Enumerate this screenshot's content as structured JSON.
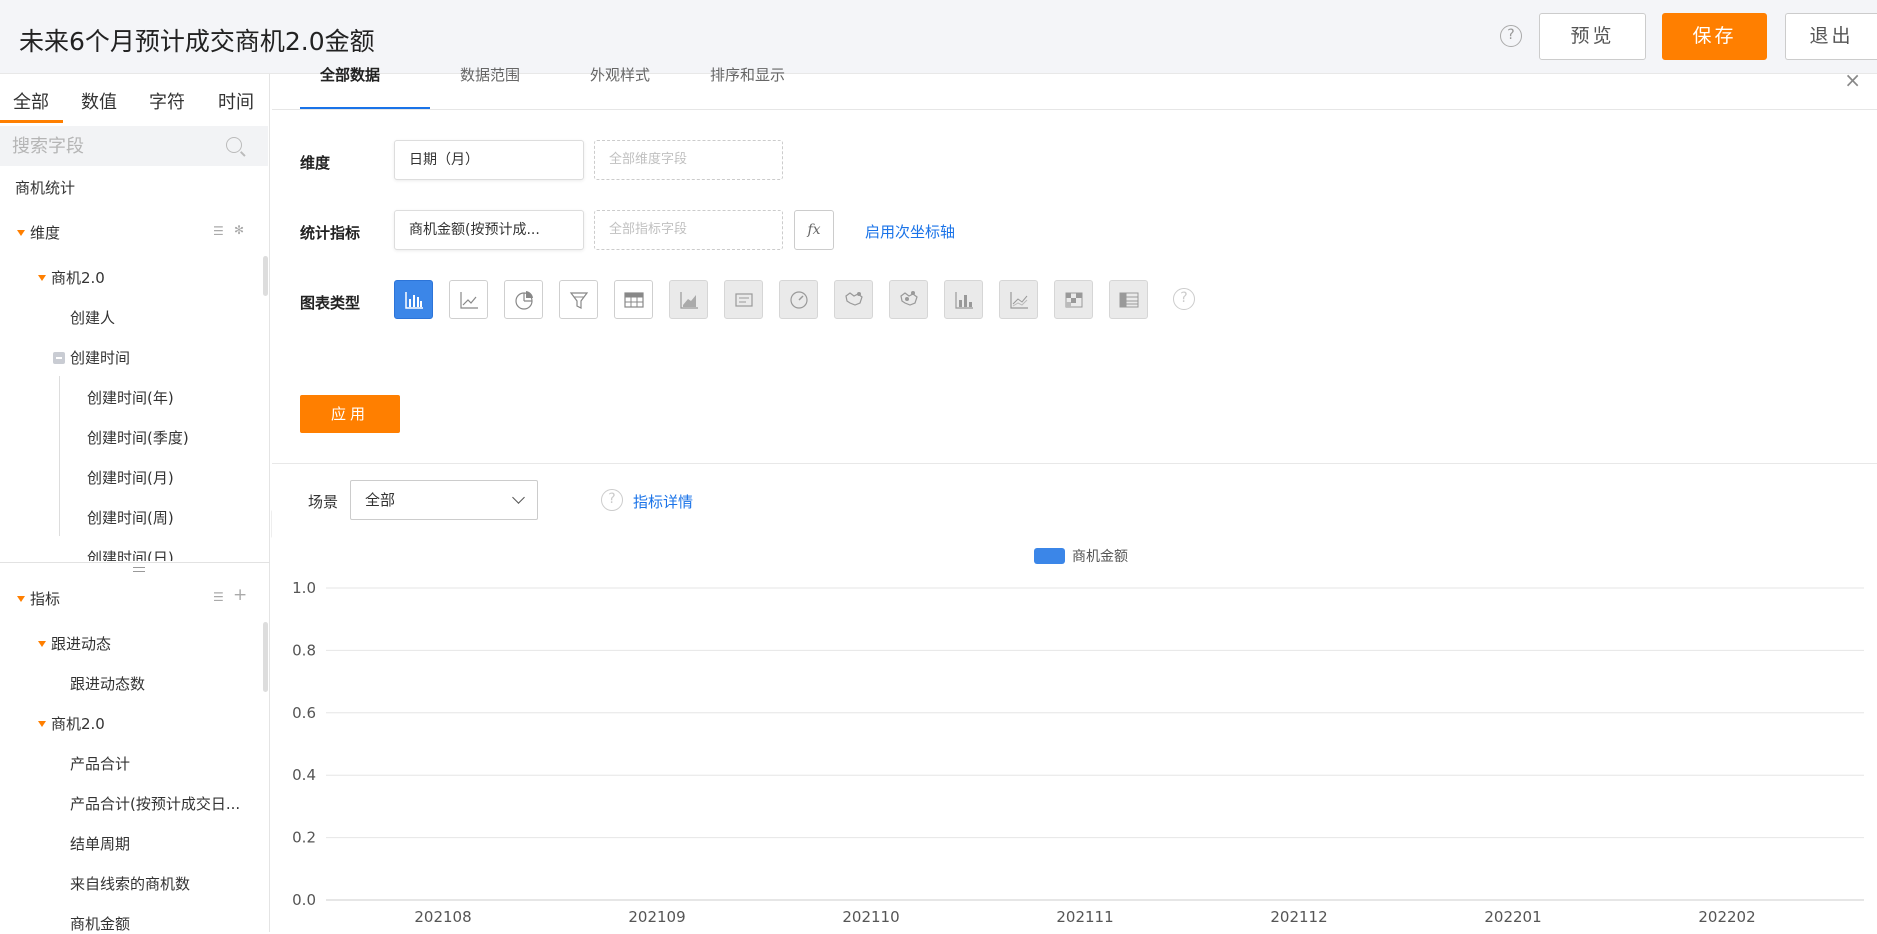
{
  "header": {
    "title": "未来6个月预计成交商机2.0金额",
    "help_glyph": "?",
    "preview_label": "预览",
    "save_label": "保存",
    "exit_label": "退出"
  },
  "sidebar": {
    "tabs": [
      "全部",
      "数值",
      "字符",
      "时间"
    ],
    "search_placeholder": "搜索字段",
    "group_title": "商机统计",
    "dimension_title": "维度",
    "dimension_items": [
      {
        "label": "商机2.0",
        "level": 1
      },
      {
        "label": "创建人",
        "level": 2
      },
      {
        "label": "创建时间",
        "level": 2
      },
      {
        "label": "创建时间(年)",
        "level": 3
      },
      {
        "label": "创建时间(季度)",
        "level": 3
      },
      {
        "label": "创建时间(月)",
        "level": 3
      },
      {
        "label": "创建时间(周)",
        "level": 3
      },
      {
        "label": "创建时间(日)",
        "level": 3
      }
    ],
    "metric_title": "指标",
    "metric_items": [
      {
        "label": "跟进动态",
        "level": 1
      },
      {
        "label": "跟进动态数",
        "level": 2
      },
      {
        "label": "商机2.0",
        "level": 1
      },
      {
        "label": "产品合计",
        "level": 2
      },
      {
        "label": "产品合计(按预计成交日...",
        "level": 2
      },
      {
        "label": "结单周期",
        "level": 2
      },
      {
        "label": "来自线索的商机数",
        "level": 2
      },
      {
        "label": "商机金额",
        "level": 2
      }
    ]
  },
  "main": {
    "tabs": [
      "全部数据",
      "数据范围",
      "外观样式",
      "排序和显示"
    ],
    "close_glyph": "×",
    "dimension_label": "维度",
    "dimension_value": "日期（月）",
    "dimension_placeholder": "全部维度字段",
    "metric_label": "统计指标",
    "metric_value": "商机金额(按预计成...",
    "metric_placeholder": "全部指标字段",
    "fx_label": "fx",
    "secondary_axis_link": "启用次坐标轴",
    "chart_type_label": "图表类型",
    "chart_type_help": "?",
    "apply_label": "应用",
    "scene_label": "场景",
    "scene_value": "全部",
    "metric_detail_help": "?",
    "metric_detail_link": "指标详情"
  },
  "colors": {
    "accent": "#ff7f00",
    "link": "#1a73e8",
    "series": "#3b86e8"
  },
  "chart_data": {
    "type": "bar",
    "categories": [
      "202108",
      "202109",
      "202110",
      "202111",
      "202112",
      "202201",
      "202202"
    ],
    "series": [
      {
        "name": "商机金额",
        "values": [
          0,
          0,
          0,
          0,
          0,
          0,
          0
        ]
      }
    ],
    "y_ticks": [
      "1.0",
      "0.8",
      "0.6",
      "0.4",
      "0.2",
      "0.0"
    ],
    "ylim": [
      0,
      1
    ],
    "grid": true,
    "legend_position": "top"
  }
}
